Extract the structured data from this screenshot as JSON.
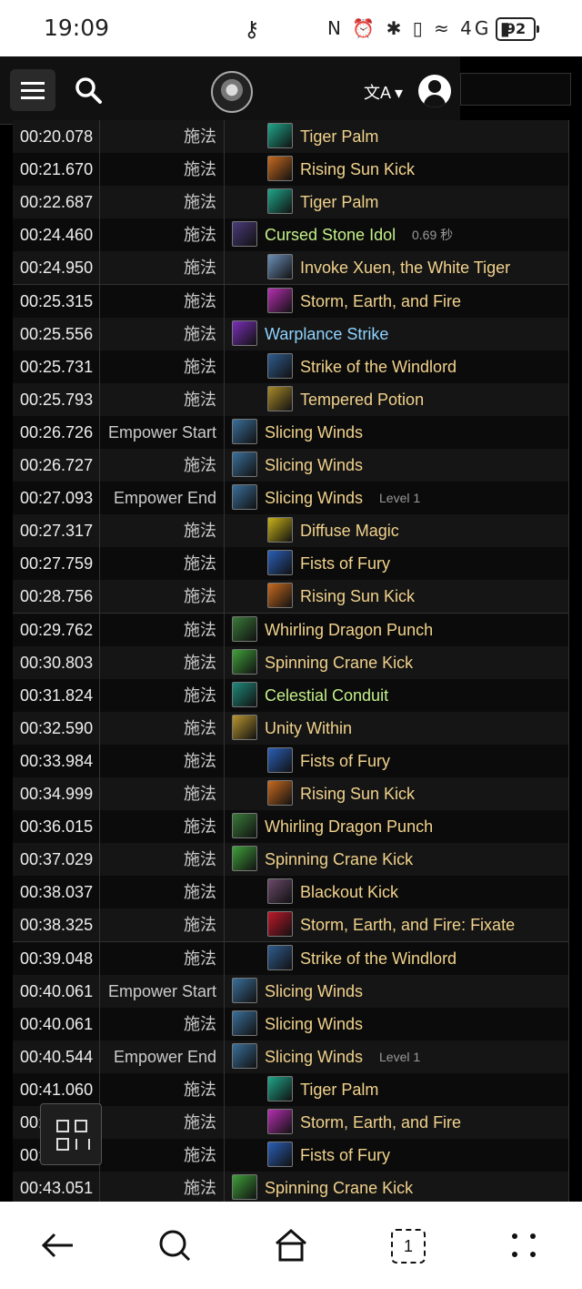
{
  "statusbar": {
    "time": "19:09",
    "battery": "92",
    "icons": "N ⏰ ✱ ▯ ≈ 4G ▮"
  },
  "header": {
    "lang_label": "文A ▾"
  },
  "rows": [
    {
      "time": "00:20.078",
      "type": "施法",
      "ability": "Tiger Palm",
      "level": 1,
      "icon_color": "#1fa68a",
      "name_color": "gold",
      "note": ""
    },
    {
      "time": "00:21.670",
      "type": "施法",
      "ability": "Rising Sun Kick",
      "level": 1,
      "icon_color": "#c76a1f",
      "name_color": "gold",
      "note": ""
    },
    {
      "time": "00:22.687",
      "type": "施法",
      "ability": "Tiger Palm",
      "level": 1,
      "icon_color": "#1fa68a",
      "name_color": "gold",
      "note": ""
    },
    {
      "time": "00:24.460",
      "type": "施法",
      "ability": "Cursed Stone Idol",
      "level": 0,
      "icon_color": "#4a3b7a",
      "name_color": "green",
      "note": "0.69 秒"
    },
    {
      "time": "00:24.950",
      "type": "施法",
      "ability": "Invoke Xuen, the White Tiger",
      "level": 1,
      "icon_color": "#6b8fb8",
      "name_color": "gold",
      "note": ""
    },
    {
      "time": "00:25.315",
      "type": "施法",
      "ability": "Storm, Earth, and Fire",
      "level": 1,
      "icon_color": "#b52fb0",
      "name_color": "gold",
      "note": ""
    },
    {
      "time": "00:25.556",
      "type": "施法",
      "ability": "Warplance Strike",
      "level": 0,
      "icon_color": "#7a2fb8",
      "name_color": "blue",
      "note": ""
    },
    {
      "time": "00:25.731",
      "type": "施法",
      "ability": "Strike of the Windlord",
      "level": 1,
      "icon_color": "#2f5c8f",
      "name_color": "gold",
      "note": ""
    },
    {
      "time": "00:25.793",
      "type": "施法",
      "ability": "Tempered Potion",
      "level": 1,
      "icon_color": "#a88a2a",
      "name_color": "gold",
      "note": ""
    },
    {
      "time": "00:26.726",
      "type": "Empower Start",
      "ability": "Slicing Winds",
      "level": 0,
      "icon_color": "#3a6f9a",
      "name_color": "gold",
      "note": ""
    },
    {
      "time": "00:26.727",
      "type": "施法",
      "ability": "Slicing Winds",
      "level": 0,
      "icon_color": "#3a6f9a",
      "name_color": "gold",
      "note": ""
    },
    {
      "time": "00:27.093",
      "type": "Empower End",
      "ability": "Slicing Winds",
      "level": 0,
      "icon_color": "#3a6f9a",
      "name_color": "gold",
      "note": "Level 1"
    },
    {
      "time": "00:27.317",
      "type": "施法",
      "ability": "Diffuse Magic",
      "level": 1,
      "icon_color": "#c9b21a",
      "name_color": "gold",
      "note": ""
    },
    {
      "time": "00:27.759",
      "type": "施法",
      "ability": "Fists of Fury",
      "level": 1,
      "icon_color": "#2a5fb8",
      "name_color": "gold",
      "note": ""
    },
    {
      "time": "00:28.756",
      "type": "施法",
      "ability": "Rising Sun Kick",
      "level": 1,
      "icon_color": "#c76a1f",
      "name_color": "gold",
      "note": ""
    },
    {
      "time": "00:29.762",
      "type": "施法",
      "ability": "Whirling Dragon Punch",
      "level": 0,
      "icon_color": "#3a7a3a",
      "name_color": "gold",
      "note": ""
    },
    {
      "time": "00:30.803",
      "type": "施法",
      "ability": "Spinning Crane Kick",
      "level": 0,
      "icon_color": "#3fa03a",
      "name_color": "gold",
      "note": ""
    },
    {
      "time": "00:31.824",
      "type": "施法",
      "ability": "Celestial Conduit",
      "level": 0,
      "icon_color": "#1f8a7a",
      "name_color": "green",
      "note": ""
    },
    {
      "time": "00:32.590",
      "type": "施法",
      "ability": "Unity Within",
      "level": 0,
      "icon_color": "#b8952f",
      "name_color": "gold",
      "note": ""
    },
    {
      "time": "00:33.984",
      "type": "施法",
      "ability": "Fists of Fury",
      "level": 1,
      "icon_color": "#2a5fb8",
      "name_color": "gold",
      "note": ""
    },
    {
      "time": "00:34.999",
      "type": "施法",
      "ability": "Rising Sun Kick",
      "level": 1,
      "icon_color": "#c76a1f",
      "name_color": "gold",
      "note": ""
    },
    {
      "time": "00:36.015",
      "type": "施法",
      "ability": "Whirling Dragon Punch",
      "level": 0,
      "icon_color": "#3a7a3a",
      "name_color": "gold",
      "note": ""
    },
    {
      "time": "00:37.029",
      "type": "施法",
      "ability": "Spinning Crane Kick",
      "level": 0,
      "icon_color": "#3fa03a",
      "name_color": "gold",
      "note": ""
    },
    {
      "time": "00:38.037",
      "type": "施法",
      "ability": "Blackout Kick",
      "level": 1,
      "icon_color": "#6a4a6a",
      "name_color": "gold",
      "note": ""
    },
    {
      "time": "00:38.325",
      "type": "施法",
      "ability": "Storm, Earth, and Fire: Fixate",
      "level": 1,
      "icon_color": "#c0182a",
      "name_color": "gold",
      "note": ""
    },
    {
      "time": "00:39.048",
      "type": "施法",
      "ability": "Strike of the Windlord",
      "level": 1,
      "icon_color": "#2f5c8f",
      "name_color": "gold",
      "note": ""
    },
    {
      "time": "00:40.061",
      "type": "Empower Start",
      "ability": "Slicing Winds",
      "level": 0,
      "icon_color": "#3a6f9a",
      "name_color": "gold",
      "note": ""
    },
    {
      "time": "00:40.061",
      "type": "施法",
      "ability": "Slicing Winds",
      "level": 0,
      "icon_color": "#3a6f9a",
      "name_color": "gold",
      "note": ""
    },
    {
      "time": "00:40.544",
      "type": "Empower End",
      "ability": "Slicing Winds",
      "level": 0,
      "icon_color": "#3a6f9a",
      "name_color": "gold",
      "note": "Level 1"
    },
    {
      "time": "00:41.060",
      "type": "施法",
      "ability": "Tiger Palm",
      "level": 1,
      "icon_color": "#1fa68a",
      "name_color": "gold",
      "note": ""
    },
    {
      "time": "00:41.0",
      "type": "施法",
      "ability": "Storm, Earth, and Fire",
      "level": 1,
      "icon_color": "#b52fb0",
      "name_color": "gold",
      "note": ""
    },
    {
      "time": "00:42.049",
      "type": "施法",
      "ability": "Fists of Fury",
      "level": 1,
      "icon_color": "#2a5fb8",
      "name_color": "gold",
      "note": ""
    },
    {
      "time": "00:43.051",
      "type": "施法",
      "ability": "Spinning Crane Kick",
      "level": 0,
      "icon_color": "#3fa03a",
      "name_color": "gold",
      "note": ""
    }
  ],
  "bottom_nav": {
    "tab_count": "1"
  }
}
